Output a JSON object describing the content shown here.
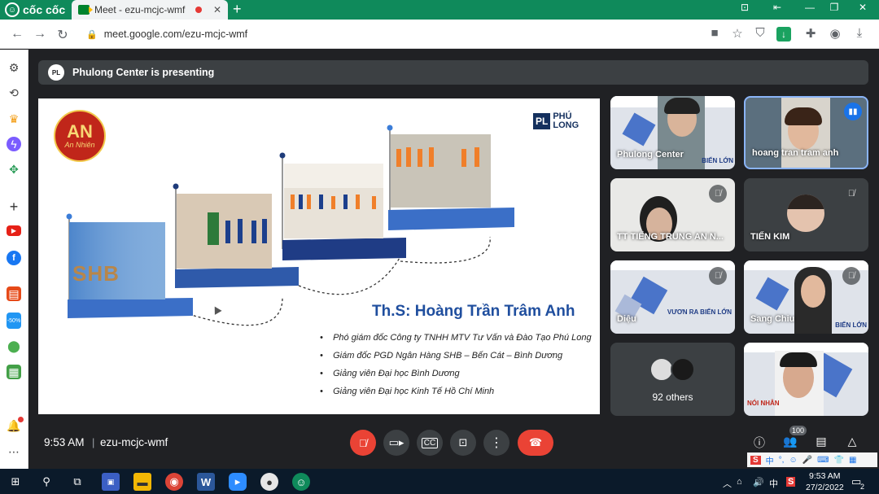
{
  "browser": {
    "brand": "cốc cốc",
    "tab_title": "Meet - ezu-mcjc-wmf",
    "url": "meet.google.com/ezu-mcjc-wmf"
  },
  "meet": {
    "presenting_text": "Phulong Center is presenting",
    "time": "9:53 AM",
    "separator": "|",
    "meeting_code": "ezu-mcjc-wmf",
    "participant_count": "100"
  },
  "slide": {
    "name": "Th.S: Hoàng Trần Trâm Anh",
    "bullets": [
      "Phó giám đốc Công ty TNHH MTV Tư Vấn và Đào Tạo Phú Long",
      "Giám đốc PGD Ngân Hàng SHB – Bến Cát – Bình Dương",
      "Giảng viên Đại học Bình Dương",
      "Giảng viên Đại học Kinh Tế Hồ Chí Minh"
    ],
    "logo_left": "An Nhiên",
    "logo_right_line1": "PHÚ",
    "logo_right_line2": "LONG",
    "logo_right_mark": "PL",
    "photo_text": "SHB"
  },
  "tiles": [
    {
      "name": "Phulong Center",
      "banner": "BIỂN LỚN"
    },
    {
      "name": "hoang tran tram anh"
    },
    {
      "name": "TT TIẾNG TRUNG AN N..."
    },
    {
      "name": "TIẾN KIM"
    },
    {
      "name": "Diệu",
      "banner": "VƯƠN RA BIỂN LỚN"
    },
    {
      "name": "Sang Chiu",
      "banner": "BIỂN LỚN"
    },
    {
      "name": "92 others"
    },
    {
      "name": "",
      "banner": "NÓI NHÂN"
    }
  ],
  "taskbar": {
    "clock_time": "9:53 AM",
    "clock_date": "27/2/2022",
    "notif_count": "2",
    "lang": "中"
  },
  "colors": {
    "coccoc_green": "#0f8a5b",
    "meet_bg": "#202124",
    "end_call_red": "#ea4335",
    "active_border": "#8ab4f8"
  }
}
